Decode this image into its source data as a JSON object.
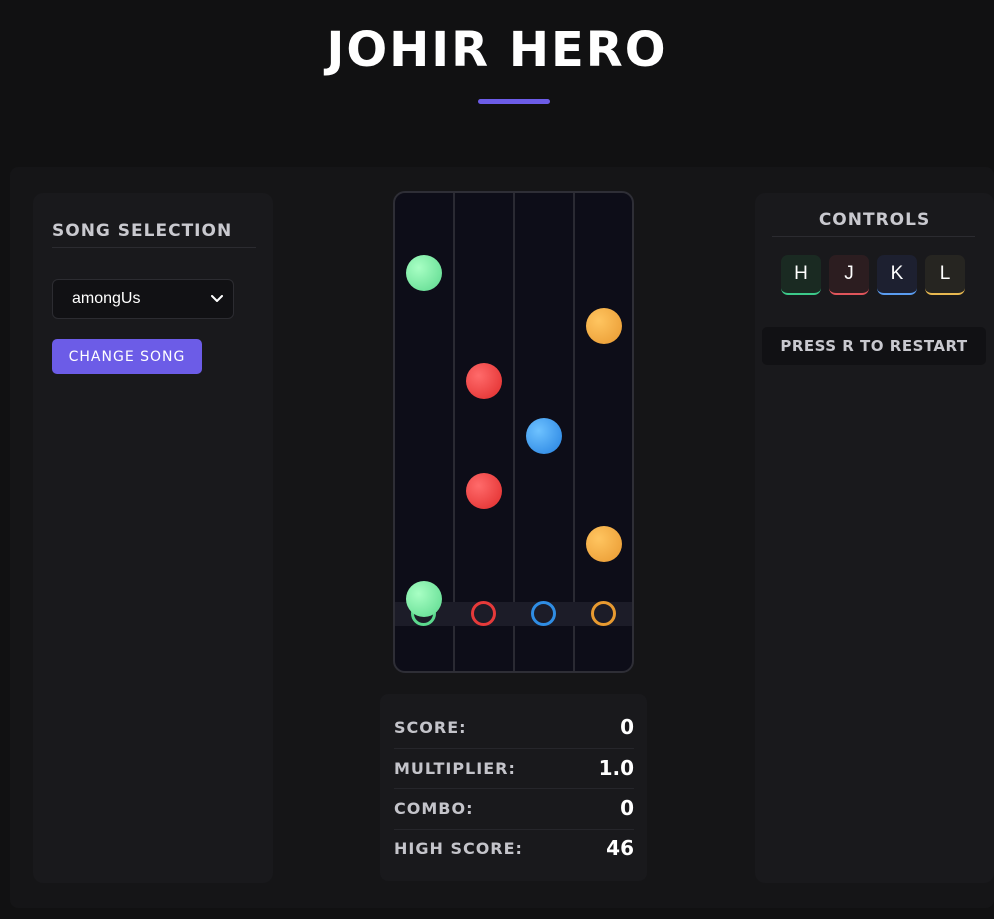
{
  "header": {
    "title": "JOHIR HERO"
  },
  "song_panel": {
    "heading": "SONG SELECTION",
    "selected_song": "amongUs",
    "change_button": "CHANGE SONG"
  },
  "board": {
    "lane_colors": [
      "#5bd88d",
      "#e63a3a",
      "#2f8de4",
      "#e89a30"
    ],
    "notes": [
      {
        "lane": 1,
        "color": "green"
      },
      {
        "lane": 1,
        "color": "green"
      },
      {
        "lane": 2,
        "color": "red"
      },
      {
        "lane": 2,
        "color": "red"
      },
      {
        "lane": 3,
        "color": "blue"
      },
      {
        "lane": 4,
        "color": "orange"
      },
      {
        "lane": 4,
        "color": "orange"
      }
    ]
  },
  "stats": {
    "score_label": "SCORE:",
    "score": "0",
    "multiplier_label": "MULTIPLIER:",
    "multiplier": "1.0",
    "combo_label": "COMBO:",
    "combo": "0",
    "high_score_label": "HIGH SCORE:",
    "high_score": "46"
  },
  "controls": {
    "heading": "CONTROLS",
    "keys": [
      "H",
      "J",
      "K",
      "L"
    ],
    "restart_hint": "PRESS R TO RESTART"
  },
  "colors": {
    "accent": "#6c5ce7"
  }
}
